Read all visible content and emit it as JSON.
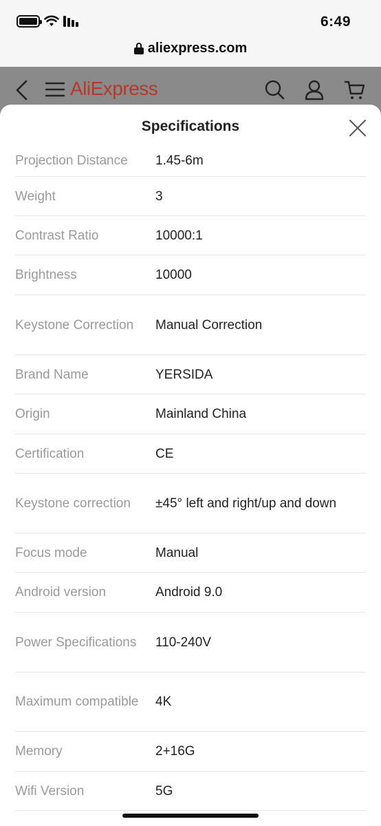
{
  "status_bar": {
    "time": "6:49",
    "url": "aliexpress.com"
  },
  "header": {
    "logo": "AliExpress"
  },
  "sheet": {
    "title": "Specifications",
    "specs": [
      {
        "label": "Projection Distance",
        "value": "1.45-6m"
      },
      {
        "label": "Weight",
        "value": "3"
      },
      {
        "label": "Contrast Ratio",
        "value": "10000:1"
      },
      {
        "label": "Brightness",
        "value": "10000"
      },
      {
        "label": "Keystone Correction",
        "value": "Manual Correction"
      },
      {
        "label": "Brand Name",
        "value": "YERSIDA"
      },
      {
        "label": "Origin",
        "value": "Mainland China"
      },
      {
        "label": "Certification",
        "value": "CE"
      },
      {
        "label": "Keystone correction",
        "value": "±45° left and right/up and down"
      },
      {
        "label": "Focus mode",
        "value": "Manual"
      },
      {
        "label": "Android version",
        "value": "Android 9.0"
      },
      {
        "label": "Power Specifications",
        "value": "110-240V"
      },
      {
        "label": "Maximum compatible",
        "value": "4K"
      },
      {
        "label": "Memory",
        "value": "2+16G"
      },
      {
        "label": "Wifi Version",
        "value": "5G"
      }
    ]
  },
  "colors": {
    "brand": "#e62e04",
    "label": "#9a9a9a",
    "value": "#222222"
  }
}
